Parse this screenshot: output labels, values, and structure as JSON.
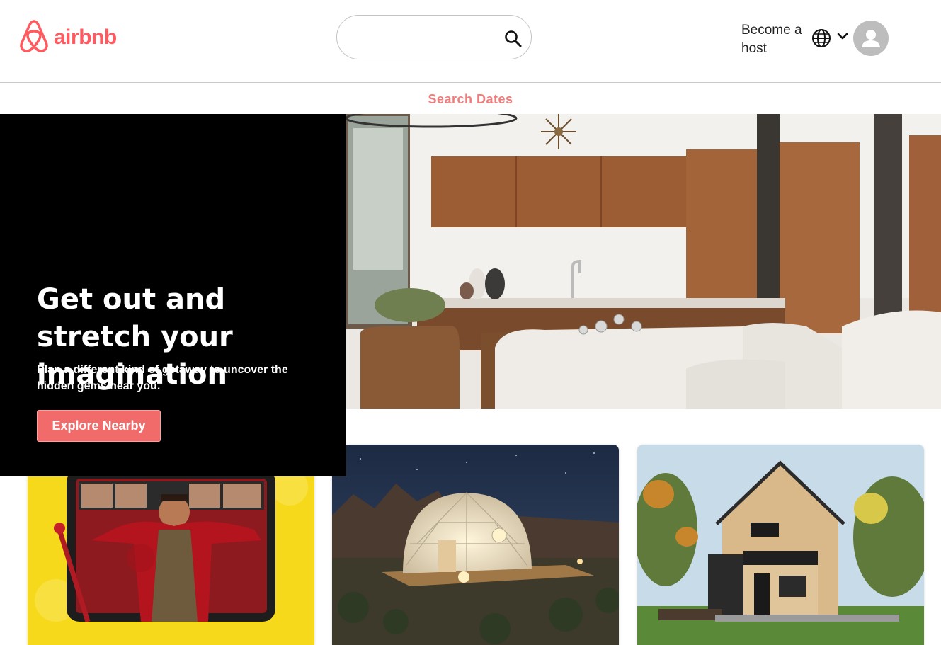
{
  "header": {
    "logo_text": "airbnb",
    "search": {
      "value": "",
      "placeholder": ""
    },
    "host_link": "Become a host"
  },
  "subnav": {
    "search_dates": "Search Dates"
  },
  "hero": {
    "title": "Get out and stretch your imagination",
    "subtitle": "Plan a different kind of getaway to uncover the hidden gems near you.",
    "button": "Explore Nearby"
  },
  "colors": {
    "brand": "#ff5a5f",
    "accent_text": "#f07c7c",
    "button": "#f26b6b",
    "hero_bg": "#000000"
  },
  "icons": [
    "airbnb-logo-icon",
    "search-icon",
    "globe-icon",
    "chevron-down-icon",
    "user-avatar-icon"
  ],
  "cards": [
    {
      "name": "online-experiences-card"
    },
    {
      "name": "glamping-dome-card"
    },
    {
      "name": "cabin-card"
    }
  ]
}
